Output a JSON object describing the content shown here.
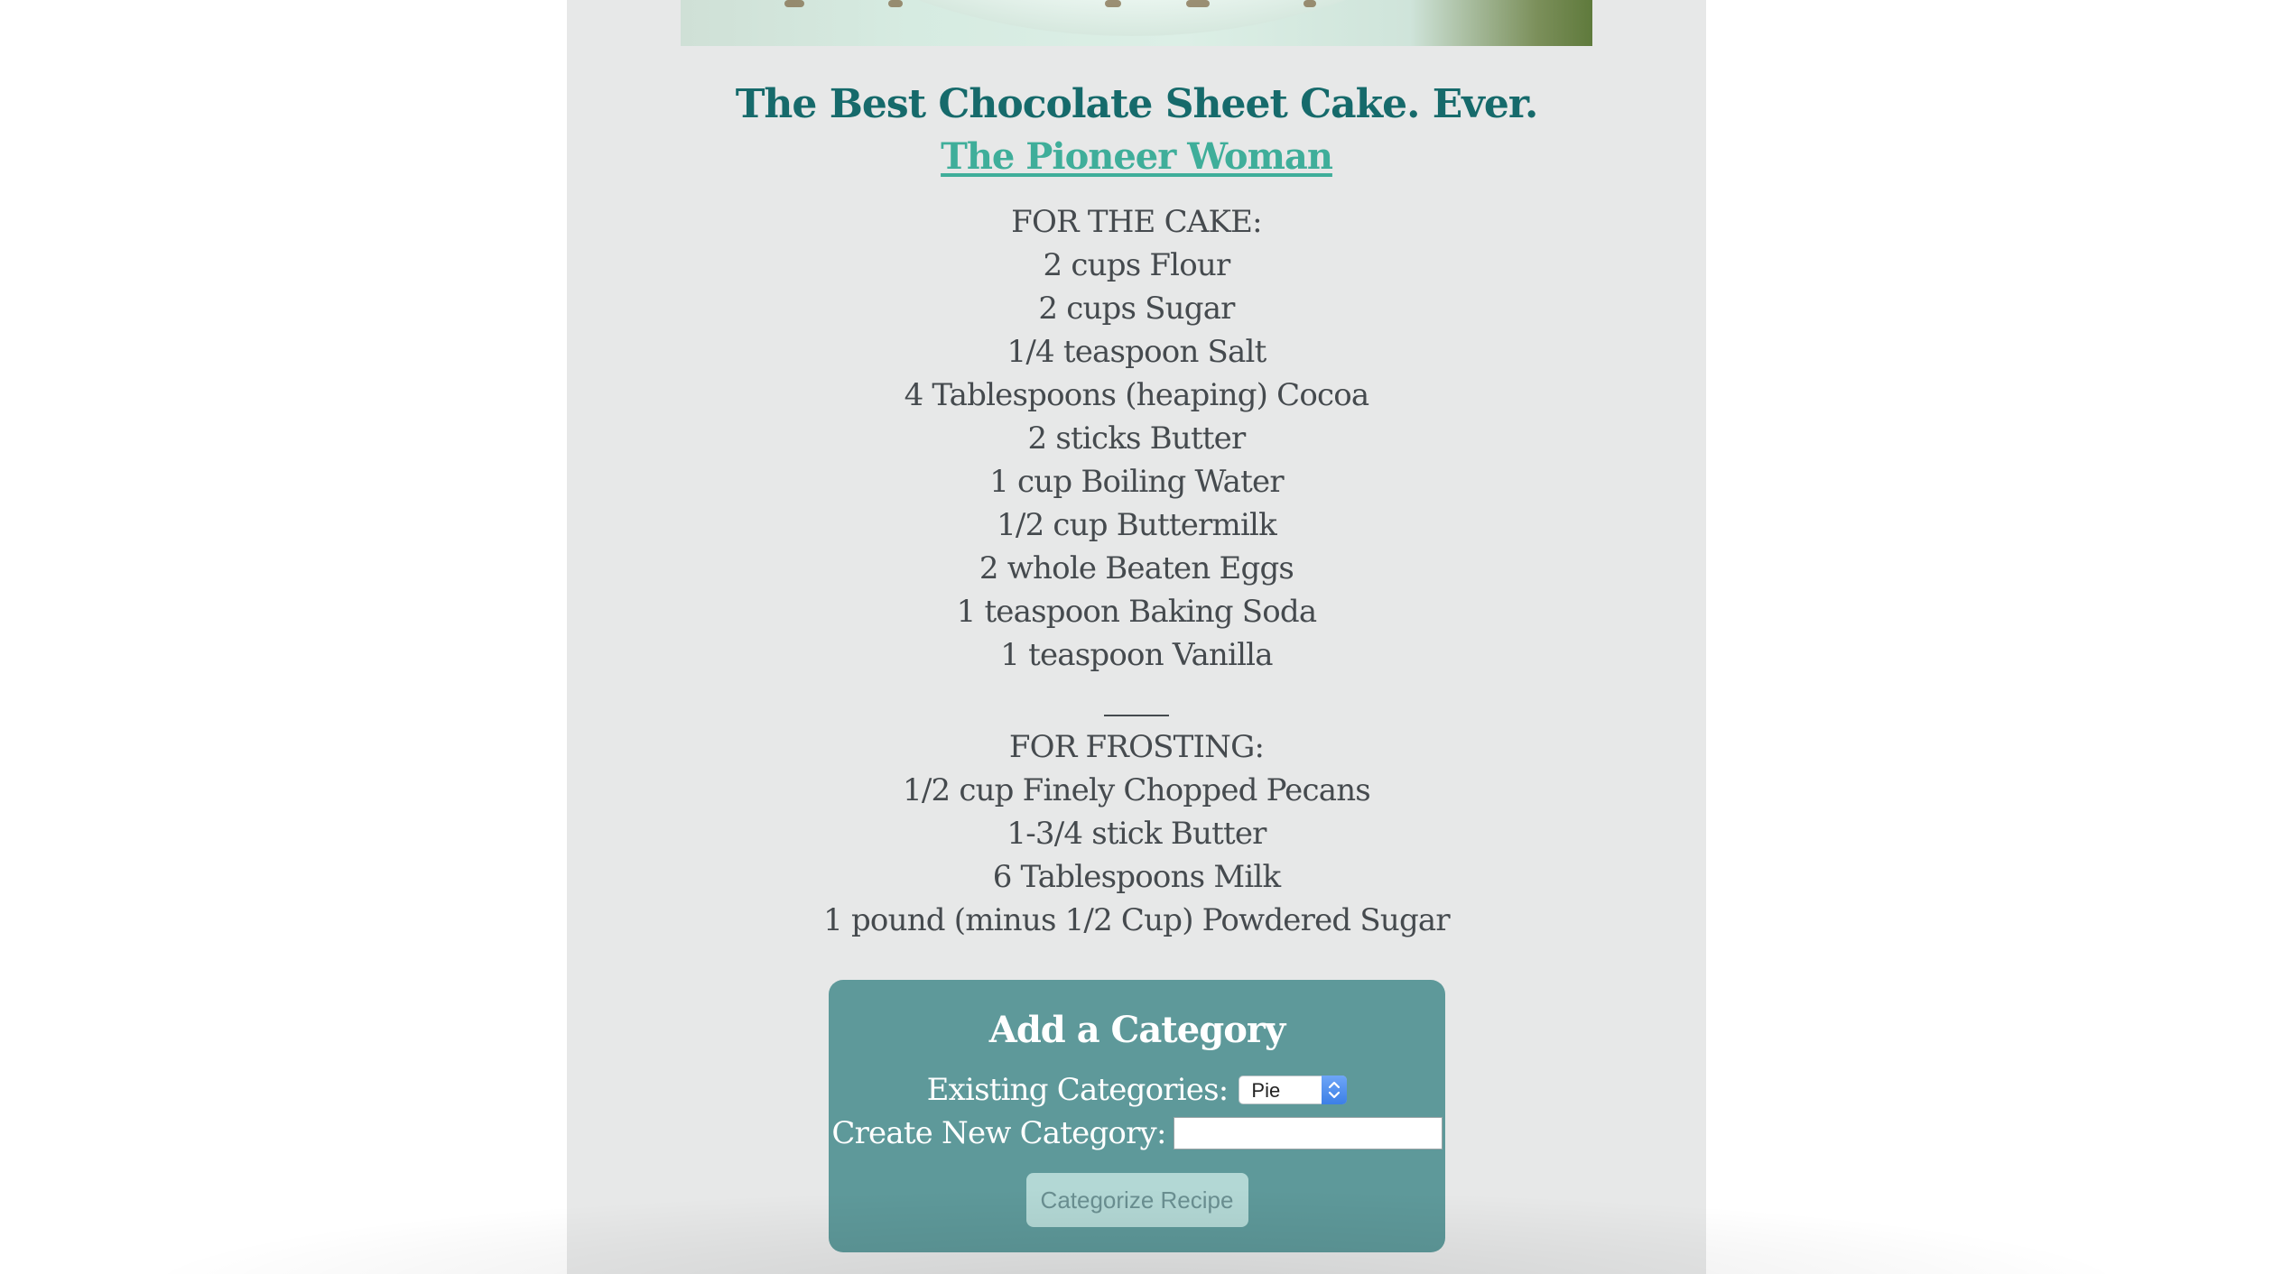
{
  "recipe": {
    "title": "The Best Chocolate Sheet Cake. Ever.",
    "source": "The Pioneer Woman",
    "cake_header": "FOR THE CAKE:",
    "cake_ingredients": [
      "2 cups Flour",
      "2 cups Sugar",
      "1/4 teaspoon Salt",
      "4 Tablespoons (heaping) Cocoa",
      "2 sticks Butter",
      "1 cup Boiling Water",
      "1/2 cup Buttermilk",
      "2 whole Beaten Eggs",
      "1 teaspoon Baking Soda",
      "1 teaspoon Vanilla"
    ],
    "frosting_header": "FOR FROSTING:",
    "frosting_ingredients": [
      "1/2 cup Finely Chopped Pecans",
      "1-3/4 stick Butter",
      "6 Tablespoons Milk",
      "1 pound (minus 1/2 Cup) Powdered Sugar"
    ]
  },
  "category_form": {
    "title": "Add a Category",
    "existing_label": "Existing Categories:",
    "existing_selected": "Pie",
    "new_label": "Create New Category:",
    "new_value": "",
    "submit_label": "Categorize Recipe"
  },
  "colors": {
    "title": "#166a6b",
    "link": "#3fae9a",
    "body_text": "#454a4e",
    "panel": "#5e999a",
    "button": "#b3d8d5",
    "column_bg": "#e7e8e8"
  },
  "icons": {
    "select_arrows": "updown-chevron-icon"
  }
}
